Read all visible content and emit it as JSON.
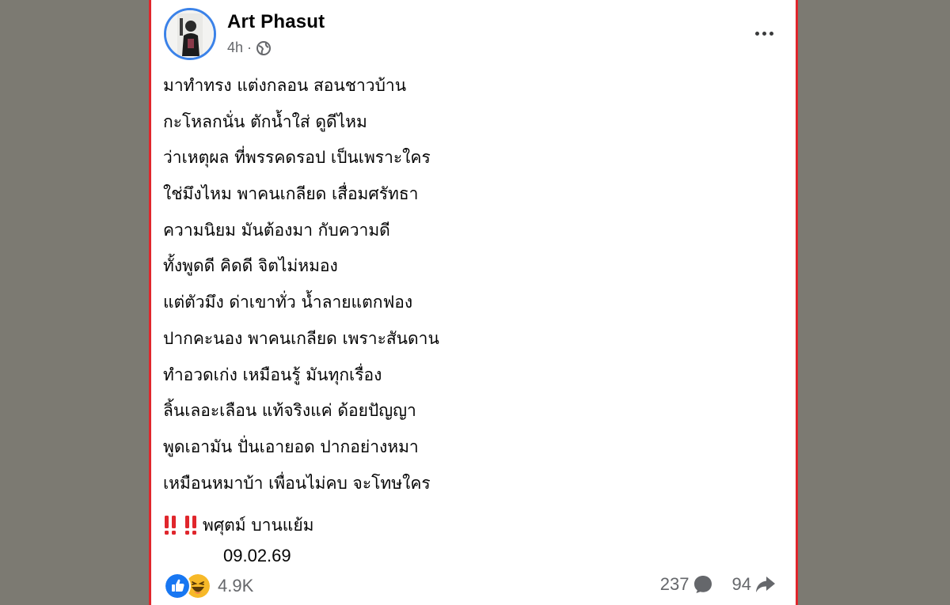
{
  "post": {
    "author": "Art Phasut",
    "time": "4h",
    "separator": "·",
    "privacy_icon": "globe-icon",
    "more_icon": "more-dots-icon",
    "lines": [
      "มาทำทรง แต่งกลอน สอนชาวบ้าน",
      "กะโหลกนั่น ตักน้ำใส่ ดูดีไหม",
      "ว่าเหตุผล ที่พรรคดรอป เป็นเพราะใคร",
      "ใช่มึงไหม พาคนเกลียด เสื่อมศรัทธา",
      "ความนิยม มันต้องมา กับความดี",
      "ทั้งพูดดี คิดดี จิตไม่หมอง",
      "แต่ตัวมึง ด่าเขาทั่ว น้ำลายแตกฟอง",
      "ปากคะนอง พาคนเกลียด เพราะสันดาน",
      "ทำอวดเก่ง เหมือนรู้ มันทุกเรื่อง",
      "ลิ้นเลอะเลือน แท้จริงแค่ ด้อยปัญญา",
      "พูดเอามัน ปั่นเอายอด ปากอย่างหมา",
      "เหมือนหมาบ้า เพื่อนไม่คบ จะโทษใคร"
    ],
    "signature": "พศุตม์ บานแย้ม",
    "signature_icons": [
      "double-exclamation-icon",
      "double-exclamation-icon"
    ],
    "date": "09.02.69"
  },
  "footer": {
    "reaction_icons": [
      "like-icon",
      "haha-icon"
    ],
    "reaction_count": "4.9K",
    "comment_count": "237",
    "share_count": "94",
    "comment_icon": "comment-icon",
    "share_icon": "share-icon"
  },
  "colors": {
    "background": "#7c7a72",
    "card": "#ffffff",
    "card_border": "#e0262c",
    "avatar_ring": "#3b82e8",
    "text": "#050505",
    "muted": "#65676b",
    "like_blue": "#1877f2",
    "haha_yellow": "#f7b928",
    "exclamation_red": "#e0262c"
  }
}
